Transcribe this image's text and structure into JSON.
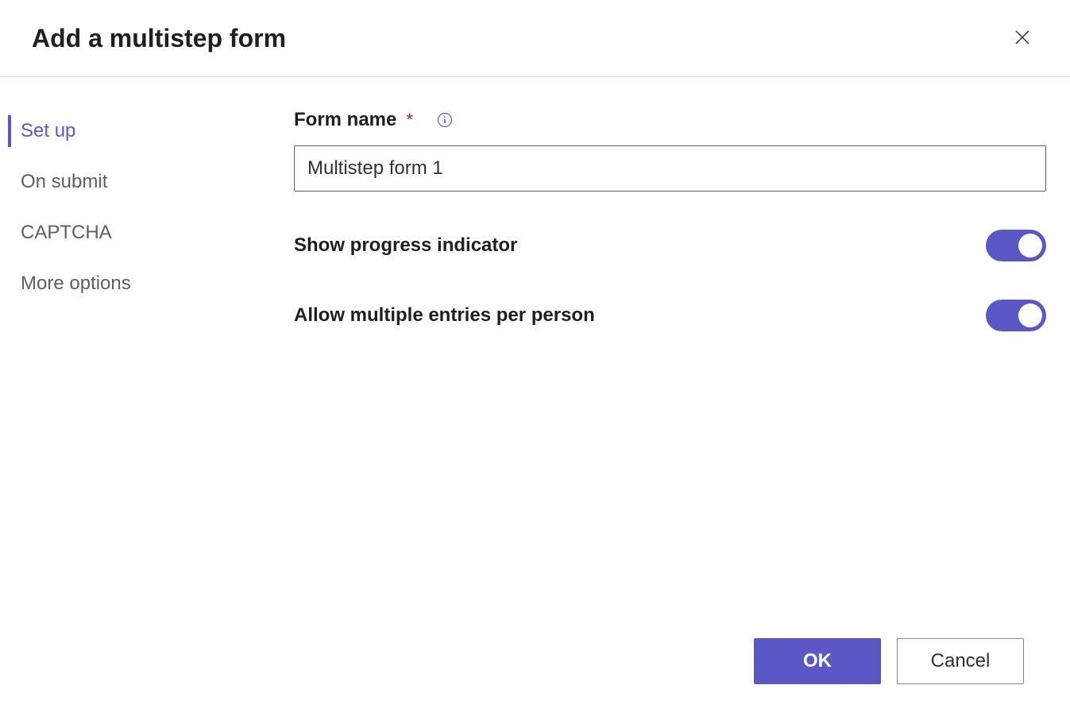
{
  "header": {
    "title": "Add a multistep form"
  },
  "sidebar": {
    "items": [
      {
        "label": "Set up",
        "selected": true
      },
      {
        "label": "On submit",
        "selected": false
      },
      {
        "label": "CAPTCHA",
        "selected": false
      },
      {
        "label": "More options",
        "selected": false
      }
    ]
  },
  "form": {
    "name_label": "Form name",
    "name_value": "Multistep form 1",
    "show_progress_label": "Show progress indicator",
    "show_progress_on": true,
    "allow_multiple_label": "Allow multiple entries per person",
    "allow_multiple_on": true
  },
  "footer": {
    "ok_label": "OK",
    "cancel_label": "Cancel"
  }
}
